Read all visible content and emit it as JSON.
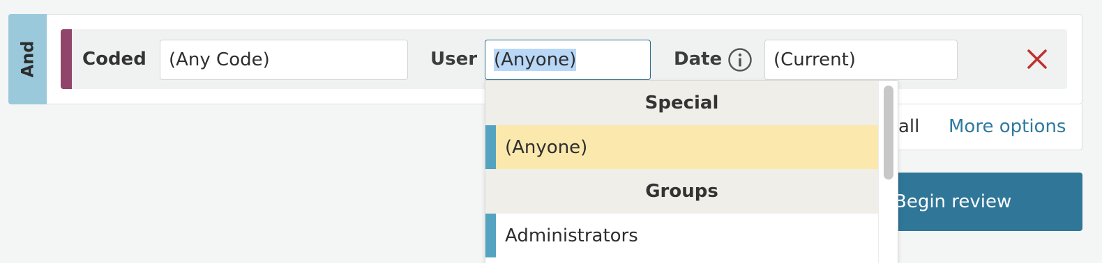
{
  "group": {
    "operator_label": "And"
  },
  "condition": {
    "coded_label": "Coded",
    "coded_value": "(Any Code)",
    "user_label": "User",
    "user_value": "(Anyone)",
    "date_label": "Date",
    "date_value": "(Current)"
  },
  "options": {
    "partial_link": "all",
    "more_options": "More options"
  },
  "actions": {
    "begin_review": "Begin review"
  },
  "dropdown": {
    "sections": [
      {
        "header": "Special",
        "items": [
          "(Anyone)"
        ]
      },
      {
        "header": "Groups",
        "items": [
          "Administrators"
        ]
      }
    ],
    "highlighted_item": "(Anyone)"
  },
  "colors": {
    "and_tab": "#9ac9dc",
    "condition_marker": "#92456a",
    "accent_blue": "#2f7698",
    "link_blue": "#2f7aa0",
    "remove_red": "#c0302f",
    "highlight_yellow": "#fbe8ad",
    "item_bar": "#54a3c1"
  },
  "icons": {
    "info": "info-circle-icon",
    "remove": "close-x-icon"
  }
}
